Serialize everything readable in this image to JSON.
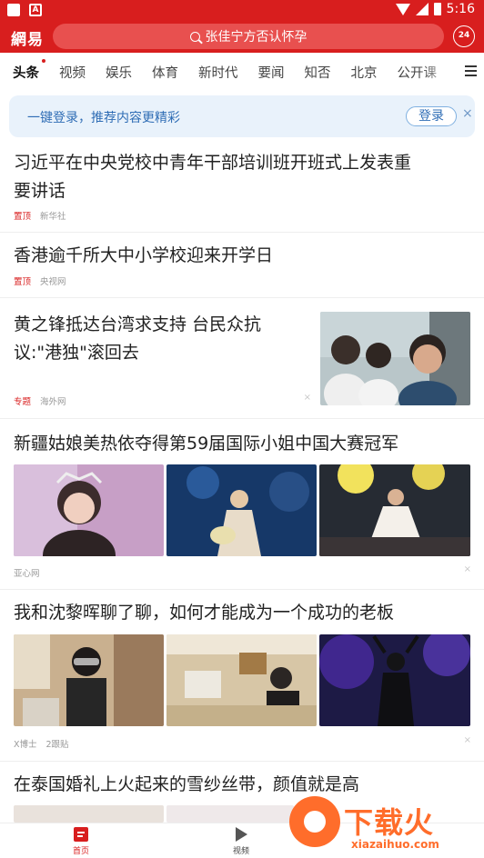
{
  "status_bar": {
    "time": "5:16"
  },
  "header": {
    "logo": "網易",
    "search_text": "张佳宁方否认怀孕",
    "clock_badge": "24"
  },
  "tabs": [
    "头条",
    "视频",
    "娱乐",
    "体育",
    "新时代",
    "要闻",
    "知否",
    "北京",
    "公开课"
  ],
  "login_banner": {
    "text": "一键登录，推荐内容更精彩",
    "button": "登录",
    "close": "×"
  },
  "news": [
    {
      "title_line1": "习近平在中央党校中青年干部培训班开班式上发表重",
      "title_line2": "要讲话",
      "tag": "置顶",
      "source": "新华社"
    },
    {
      "title_line1": "香港逾千所大中小学校迎来开学日",
      "tag": "置顶",
      "source": "央视网"
    },
    {
      "title_line1": "黄之锋抵达台湾求支持 台民众抗",
      "title_line2": "议:\"港独\"滚回去",
      "tag": "专题",
      "source": "海外网",
      "close": "×"
    },
    {
      "title_line1": "新疆姑娘美热依夺得第59届国际小姐中国大赛冠军",
      "source": "亚心网",
      "close": "×"
    },
    {
      "title_line1": "我和沈黎晖聊了聊，如何才能成为一个成功的老板",
      "source": "X博士",
      "comments": "2跟贴",
      "close": "×"
    },
    {
      "title_line1": "在泰国婚礼上火起来的雪纱丝带，颜值就是高"
    }
  ],
  "bottom_nav": {
    "home": "首页",
    "video": "视频"
  },
  "watermark": {
    "text": "下载火",
    "url": "xiazaihuo.com"
  },
  "colors": {
    "brand_red": "#d81e1e",
    "login_blue": "#2f6db5",
    "watermark_orange": "#ff6d2b"
  }
}
